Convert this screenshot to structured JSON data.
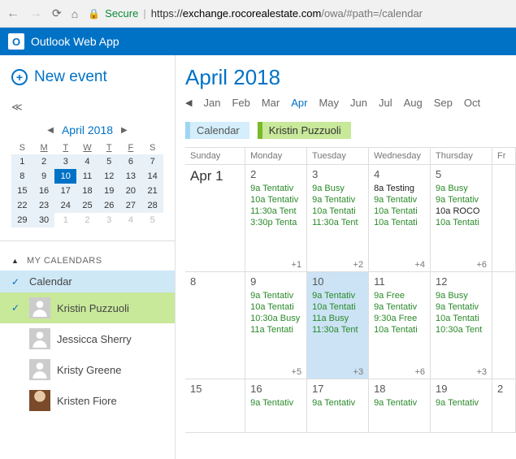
{
  "browser": {
    "secure_label": "Secure",
    "url_proto": "https://",
    "url_host": "exchange.rocorealestate.com",
    "url_path": "/owa/#path=/calendar"
  },
  "app": {
    "logo_letter": "O",
    "name": "Outlook Web App"
  },
  "sidebar": {
    "new_event": "New event",
    "mini_title": "April 2018",
    "dow": [
      "S",
      "M",
      "T",
      "W",
      "T",
      "F",
      "S"
    ],
    "mini_weeks": [
      [
        {
          "n": "1",
          "s": true
        },
        {
          "n": "2",
          "s": true
        },
        {
          "n": "3",
          "s": true
        },
        {
          "n": "4",
          "s": true
        },
        {
          "n": "5",
          "s": true
        },
        {
          "n": "6",
          "s": true
        },
        {
          "n": "7",
          "s": true
        }
      ],
      [
        {
          "n": "8",
          "s": true
        },
        {
          "n": "9",
          "s": true
        },
        {
          "n": "10",
          "s": true,
          "today": true
        },
        {
          "n": "11",
          "s": true
        },
        {
          "n": "12",
          "s": true
        },
        {
          "n": "13",
          "s": true
        },
        {
          "n": "14",
          "s": true
        }
      ],
      [
        {
          "n": "15",
          "s": true
        },
        {
          "n": "16",
          "s": true
        },
        {
          "n": "17",
          "s": true
        },
        {
          "n": "18",
          "s": true
        },
        {
          "n": "19",
          "s": true
        },
        {
          "n": "20",
          "s": true
        },
        {
          "n": "21",
          "s": true
        }
      ],
      [
        {
          "n": "22",
          "s": true
        },
        {
          "n": "23",
          "s": true
        },
        {
          "n": "24",
          "s": true
        },
        {
          "n": "25",
          "s": true
        },
        {
          "n": "26",
          "s": true
        },
        {
          "n": "27",
          "s": true
        },
        {
          "n": "28",
          "s": true
        }
      ],
      [
        {
          "n": "29",
          "s": true
        },
        {
          "n": "30",
          "s": true
        },
        {
          "n": "1",
          "o": true
        },
        {
          "n": "2",
          "o": true
        },
        {
          "n": "3",
          "o": true
        },
        {
          "n": "4",
          "o": true
        },
        {
          "n": "5",
          "o": true
        }
      ]
    ],
    "section_title": "MY CALENDARS",
    "cals": [
      {
        "name": "Calendar",
        "checked": true,
        "sel": "blue",
        "avatar": false
      },
      {
        "name": "Kristin Puzzuoli",
        "checked": true,
        "sel": "green",
        "avatar": true
      },
      {
        "name": "Jessicca Sherry",
        "checked": false,
        "sel": "",
        "avatar": true
      },
      {
        "name": "Kristy Greene",
        "checked": false,
        "sel": "",
        "avatar": true
      },
      {
        "name": "Kristen Fiore",
        "checked": false,
        "sel": "",
        "avatar": true,
        "photo": true
      }
    ]
  },
  "main": {
    "title": "April 2018",
    "months": [
      "Jan",
      "Feb",
      "Mar",
      "Apr",
      "May",
      "Jun",
      "Jul",
      "Aug",
      "Sep",
      "Oct"
    ],
    "current_month_index": 3,
    "tags": [
      {
        "label": "Calendar",
        "cls": "blue"
      },
      {
        "label": "Kristin Puzzuoli",
        "cls": "green"
      }
    ],
    "dow": [
      "Sunday",
      "Monday",
      "Tuesday",
      "Wednesday",
      "Thursday",
      "Fr"
    ],
    "weeks": [
      {
        "days": [
          {
            "num": "Apr 1",
            "big": true,
            "events": [],
            "more": ""
          },
          {
            "num": "2",
            "events": [
              {
                "t": "9a Tentativ"
              },
              {
                "t": "10a Tentativ"
              },
              {
                "t": "11:30a Tent"
              },
              {
                "t": "3:30p Tenta"
              }
            ],
            "more": "+1"
          },
          {
            "num": "3",
            "events": [
              {
                "t": "9a Busy"
              },
              {
                "t": "9a Tentativ"
              },
              {
                "t": "10a Tentati"
              },
              {
                "t": "11:30a Tent"
              }
            ],
            "more": "+2"
          },
          {
            "num": "4",
            "events": [
              {
                "t": "8a Testing",
                "cls": "black"
              },
              {
                "t": "9a Tentativ"
              },
              {
                "t": "10a Tentati"
              },
              {
                "t": "10a Tentati"
              }
            ],
            "more": "+4"
          },
          {
            "num": "5",
            "events": [
              {
                "t": "9a Busy"
              },
              {
                "t": "9a Tentativ"
              },
              {
                "t": "10a ROCO",
                "cls": "black"
              },
              {
                "t": "10a Tentati"
              }
            ],
            "more": "+6"
          },
          {
            "num": "",
            "events": [],
            "more": ""
          }
        ]
      },
      {
        "days": [
          {
            "num": "8",
            "events": [],
            "more": ""
          },
          {
            "num": "9",
            "events": [
              {
                "t": "9a Tentativ"
              },
              {
                "t": "10a Tentati"
              },
              {
                "t": "10:30a Busy"
              },
              {
                "t": "11a Tentati"
              }
            ],
            "more": "+5"
          },
          {
            "num": "10",
            "today": true,
            "events": [
              {
                "t": "9a Tentativ"
              },
              {
                "t": "10a Tentati"
              },
              {
                "t": "11a Busy"
              },
              {
                "t": "11:30a Tent"
              }
            ],
            "more": "+3"
          },
          {
            "num": "11",
            "events": [
              {
                "t": "9a Free"
              },
              {
                "t": "9a Tentativ"
              },
              {
                "t": "9:30a Free"
              },
              {
                "t": "10a Tentati"
              }
            ],
            "more": "+6"
          },
          {
            "num": "12",
            "events": [
              {
                "t": "9a Busy"
              },
              {
                "t": "9a Tentativ"
              },
              {
                "t": "10a Tentati"
              },
              {
                "t": "10:30a Tent"
              }
            ],
            "more": "+3"
          },
          {
            "num": "",
            "events": [],
            "more": ""
          }
        ]
      },
      {
        "short": true,
        "days": [
          {
            "num": "15",
            "events": [],
            "more": ""
          },
          {
            "num": "16",
            "events": [
              {
                "t": "9a Tentativ"
              }
            ],
            "more": ""
          },
          {
            "num": "17",
            "events": [
              {
                "t": "9a Tentativ"
              }
            ],
            "more": ""
          },
          {
            "num": "18",
            "events": [
              {
                "t": "9a Tentativ"
              }
            ],
            "more": ""
          },
          {
            "num": "19",
            "events": [
              {
                "t": "9a Tentativ"
              }
            ],
            "more": ""
          },
          {
            "num": "2",
            "events": [],
            "more": ""
          }
        ]
      }
    ]
  }
}
